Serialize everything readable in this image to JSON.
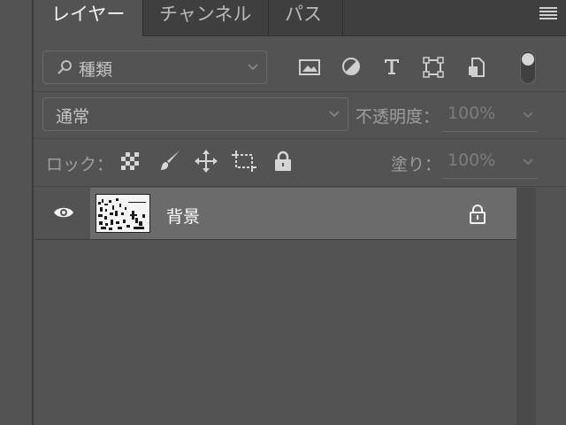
{
  "tabs": [
    {
      "label": "レイヤー",
      "active": true
    },
    {
      "label": "チャンネル",
      "active": false
    },
    {
      "label": "パス",
      "active": false
    }
  ],
  "filter": {
    "kind_value": "種類",
    "icons": [
      "image-filter-icon",
      "adjustment-filter-icon",
      "type-filter-icon",
      "shape-filter-icon",
      "smart-object-filter-icon"
    ]
  },
  "blend": {
    "mode_value": "通常",
    "opacity_label": "不透明度：",
    "opacity_value": "100%"
  },
  "lock": {
    "label": "ロック：",
    "fill_label": "塗り：",
    "fill_value": "100%"
  },
  "layers": [
    {
      "name": "背景",
      "visible": true,
      "locked": true
    }
  ],
  "colors": {
    "panel_bg": "#535353",
    "selected_row_bg": "#6b6b6b",
    "tabbar_bg": "#3f3f3f"
  }
}
